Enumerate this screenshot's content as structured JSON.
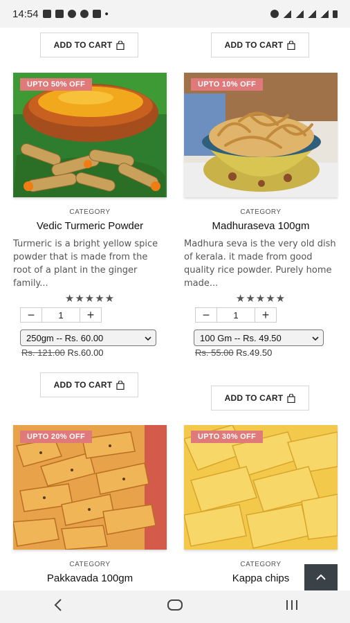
{
  "status_bar": {
    "time": "14:54",
    "dot": "•"
  },
  "add_to_cart_label": "ADD TO CART",
  "products": [
    {
      "badge": "UPTO 50% OFF",
      "category": "CATEGORY",
      "title": "Vedic Turmeric Powder",
      "description": "Turmeric is a bright yellow spice powder that is made from the root of a plant in the ginger family...",
      "rating_stars": "★★★★★",
      "quantity": "1",
      "variant": "250gm -- Rs. 60.00",
      "price_old": "Rs. 121.00",
      "price_new": "Rs.60.00"
    },
    {
      "badge": "UPTO 10% OFF",
      "category": "CATEGORY",
      "title": "Madhuraseva 100gm",
      "description": "Madhura seva is the very old dish of kerala. it made from good quality rice powder. Purely home made...",
      "rating_stars": "★★★★★",
      "quantity": "1",
      "variant": "100 Gm -- Rs. 49.50",
      "price_old": "Rs. 55.00",
      "price_new": "Rs.49.50"
    },
    {
      "badge": "UPTO 20% OFF",
      "category": "CATEGORY",
      "title": "Pakkavada 100gm"
    },
    {
      "badge": "UPTO 30% OFF",
      "category": "CATEGORY",
      "title": "Kappa chips"
    }
  ],
  "icons": {
    "bag": "shopping-bag-icon",
    "minus": "minus-icon",
    "plus": "plus-icon",
    "chevron": "chevron-down-icon",
    "scroll_top": "chevron-up-icon",
    "nav_back": "back-icon",
    "nav_home": "home-icon",
    "nav_recents": "recents-icon"
  },
  "colors": {
    "badge": "#e07a7a",
    "scroll_top": "#3a4147"
  }
}
